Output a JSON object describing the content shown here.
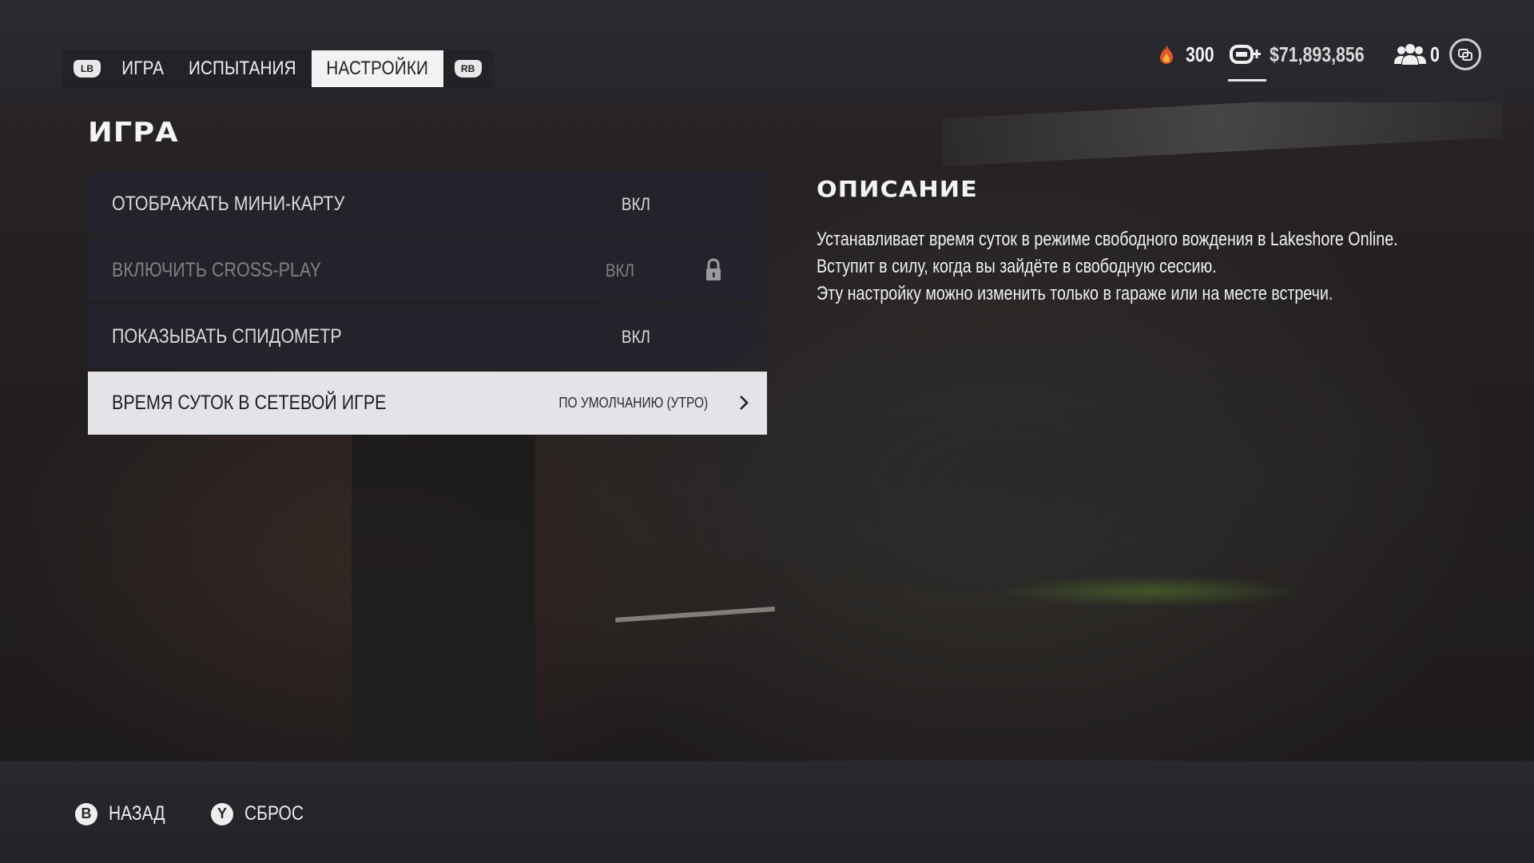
{
  "header": {
    "tabs": {
      "lb_label": "LB",
      "rb_label": "RB",
      "items": [
        {
          "label": "ИГРА"
        },
        {
          "label": "ИСПЫТАНИЯ"
        },
        {
          "label": "НАСТРОЙКИ"
        }
      ],
      "active_index": 2
    },
    "currency": {
      "rep_value": "300",
      "cash_value": "$71,893,856",
      "crew_value": "0"
    }
  },
  "section": {
    "title": "ИГРА"
  },
  "settings": [
    {
      "label": "ОТОБРАЖАТЬ МИНИ-КАРТУ",
      "value": "ВКЛ"
    },
    {
      "label": "ВКЛЮЧИТЬ CROSS-PLAY",
      "value": "ВКЛ",
      "locked": true
    },
    {
      "label": "ПОКАЗЫВАТЬ СПИДОМЕТР",
      "value": "ВКЛ"
    },
    {
      "label": "ВРЕМЯ СУТОК В СЕТЕВОЙ ИГРЕ",
      "value": "ПО УМОЛЧАНИЮ (УТРО)",
      "selected": true
    }
  ],
  "description": {
    "title": "ОПИСАНИЕ",
    "lines": [
      "Устанавливает время суток в режиме свободного вождения в Lakeshore Online.",
      "Вступит в силу, когда вы зайдёте в свободную сессию.",
      "Эту настройку можно изменить только в гараже или на месте встречи."
    ]
  },
  "footer": {
    "back": {
      "button": "B",
      "label": "НАЗАД"
    },
    "reset": {
      "button": "Y",
      "label": "СБРОС"
    }
  },
  "colors": {
    "selected_row": "#e3e3e8",
    "row_bg": "#24252c",
    "rep_flame": "#e0562a",
    "text": "#f0f0f0"
  }
}
